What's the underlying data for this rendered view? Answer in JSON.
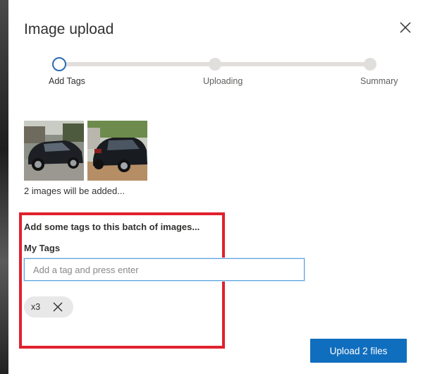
{
  "dialog": {
    "title": "Image upload",
    "close_icon": "close-icon"
  },
  "stepper": {
    "steps": [
      {
        "label": "Add Tags",
        "state": "active"
      },
      {
        "label": "Uploading",
        "state": "pending"
      },
      {
        "label": "Summary",
        "state": "pending"
      }
    ]
  },
  "images": {
    "thumbnails": [
      "car-photo-front",
      "car-photo-rear"
    ],
    "caption": "2 images will be added..."
  },
  "tags": {
    "heading": "Add some tags to this batch of images...",
    "label": "My Tags",
    "input_placeholder": "Add a tag and press enter",
    "input_value": "",
    "chips": [
      {
        "label": "x3",
        "remove_icon": "close-icon"
      }
    ]
  },
  "footer": {
    "upload_label": "Upload 2 files"
  },
  "colors": {
    "primary": "#106ebe",
    "active_step": "#2b6cb0",
    "highlight": "#e0212d"
  }
}
